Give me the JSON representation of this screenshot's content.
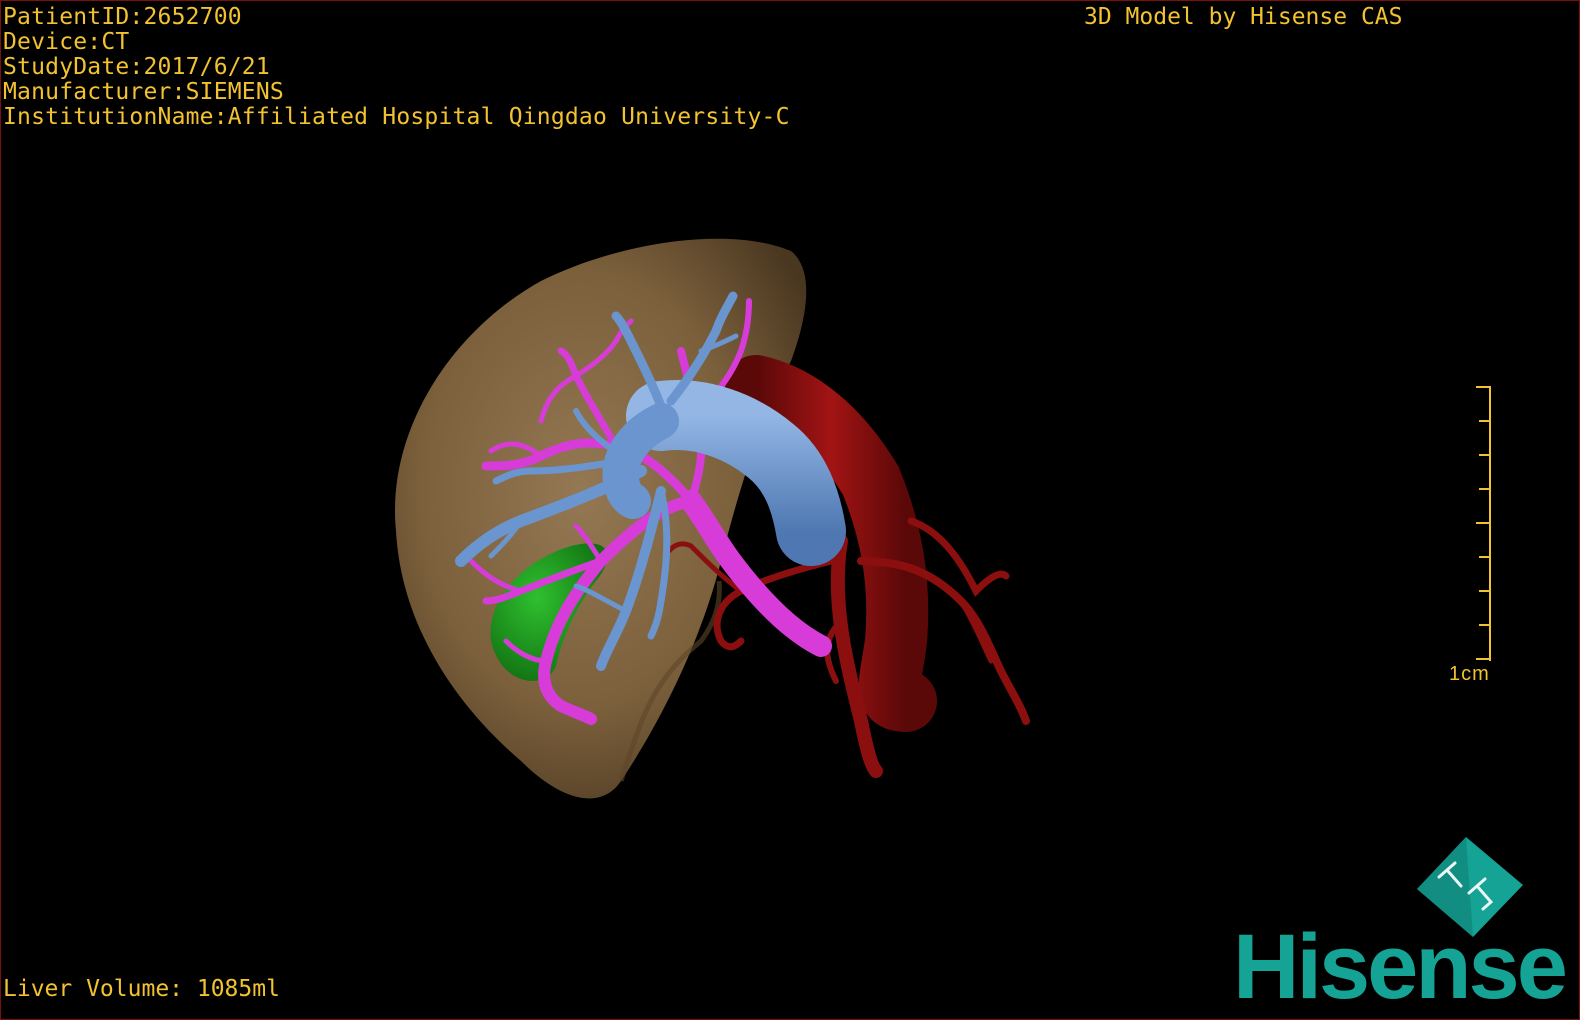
{
  "header": {
    "patient_id": "PatientID:2652700",
    "device": "Device:CT",
    "study_date": "StudyDate:2017/6/21",
    "manufacturer": "Manufacturer:SIEMENS",
    "institution": "InstitutionName:Affiliated Hospital Qingdao University-C"
  },
  "credit": "3D Model by Hisense CAS",
  "footer": {
    "liver_volume": "Liver Volume: 1085ml"
  },
  "scale": {
    "label": "1cm"
  },
  "brand": {
    "name": "Hisense",
    "color": "#14a394"
  },
  "colors": {
    "overlay_text": "#f2c230",
    "liver": "#8a6c48",
    "portal_vein": "#d83cd8",
    "hepatic_vein": "#6b95cf",
    "artery": "#8c0f0f",
    "gallbladder": "#1f9a1f"
  },
  "structures": [
    "liver",
    "hepatic-vein",
    "portal-vein",
    "artery",
    "gallbladder"
  ]
}
